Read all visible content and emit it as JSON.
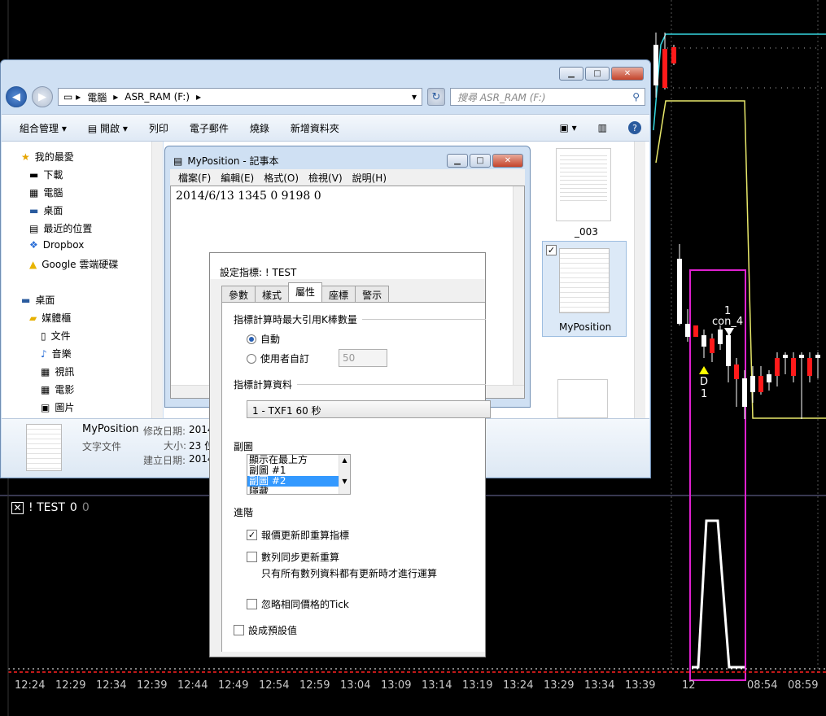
{
  "chart": {
    "time_labels": [
      "12:24",
      "12:29",
      "12:34",
      "12:39",
      "12:44",
      "12:49",
      "12:54",
      "12:59",
      "13:04",
      "13:09",
      "13:14",
      "13:19",
      "13:24",
      "13:29",
      "13:34",
      "13:39",
      "12",
      "08:54",
      "08:59"
    ],
    "indicator_label": "! TEST",
    "indicator_value": "0",
    "indicator_value2": "0",
    "annotation_top": "1",
    "annotation_con": "con_4",
    "annotation_d": "D",
    "annotation_d_num": "1",
    "colors": {
      "background": "#000000",
      "cyan": "#35d6e0",
      "yellow": "#e8e86a",
      "magenta": "#e020d0",
      "red": "#ff1a1a",
      "white": "#ffffff"
    }
  },
  "explorer": {
    "breadcrumb": [
      "電腦",
      "ASR_RAM (F:)"
    ],
    "search_placeholder": "搜尋 ASR_RAM (F:)",
    "toolbar": [
      "組合管理",
      "開啟",
      "列印",
      "電子郵件",
      "燒錄",
      "新增資料夾"
    ],
    "favorites_header": "我的最愛",
    "nav_items": [
      "下載",
      "電腦",
      "桌面",
      "最近的位置",
      "Dropbox",
      "Google 雲端硬碟"
    ],
    "desktop_header": "桌面",
    "library_header": "媒體櫃",
    "library_items": [
      "文件",
      "音樂",
      "視訊",
      "電影",
      "圖片"
    ],
    "files": [
      {
        "name": "_003"
      },
      {
        "name": "MyPosition"
      }
    ],
    "details": {
      "name": "MyPosition",
      "type": "文字文件",
      "modified_label": "修改日期:",
      "modified_value": "2014",
      "size_label": "大小:",
      "size_value": "23 位",
      "created_label": "建立日期:",
      "created_value": "2014"
    }
  },
  "notepad": {
    "title": "MyPosition - 記事本",
    "menu": [
      "檔案(F)",
      "編輯(E)",
      "格式(O)",
      "檢視(V)",
      "說明(H)"
    ],
    "content": "2014/6/13 1345 0 9198 0"
  },
  "dialog": {
    "title": "設定指標: ! TEST",
    "tabs": [
      "參數",
      "樣式",
      "屬性",
      "座標",
      "警示"
    ],
    "active_tab": "屬性",
    "section1": "指標計算時最大引用K棒數量",
    "radio_auto": "自動",
    "radio_user": "使用者自訂",
    "user_value": "50",
    "section2": "指標計算資料",
    "data_select": "1 - TXF1 60 秒",
    "section3": "副圖",
    "subchart_options": [
      "顯示在最上方",
      "副圖 #1",
      "副圖 #2",
      "隱藏"
    ],
    "subchart_selected": "副圖 #2",
    "section4": "進階",
    "chk1": "報價更新即重算指標",
    "chk2": "數列同步更新重算",
    "chk2_note": "只有所有數列資料都有更新時才進行運算",
    "chk3": "忽略相同價格的Tick",
    "chk4": "設成預設值"
  }
}
